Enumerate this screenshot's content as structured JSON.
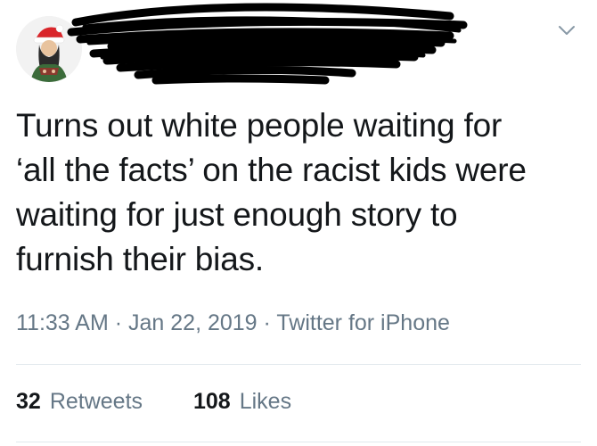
{
  "tweet": {
    "lines": [
      "Turns out white people waiting for",
      "‘all the facts’ on the racist kids were",
      "waiting for just enough story to",
      "furnish their bias."
    ],
    "time": "11:33 AM",
    "date": "Jan 22, 2019",
    "source": "Twitter for iPhone",
    "separator": "·"
  },
  "stats": {
    "retweets_count": "32",
    "retweets_label": "Retweets",
    "likes_count": "108",
    "likes_label": "Likes"
  },
  "icons": {
    "menu": "chevron-down-icon",
    "avatar": "avatar"
  },
  "colors": {
    "text": "#14171a",
    "secondary": "#657786",
    "divider": "#e1e8ed"
  }
}
